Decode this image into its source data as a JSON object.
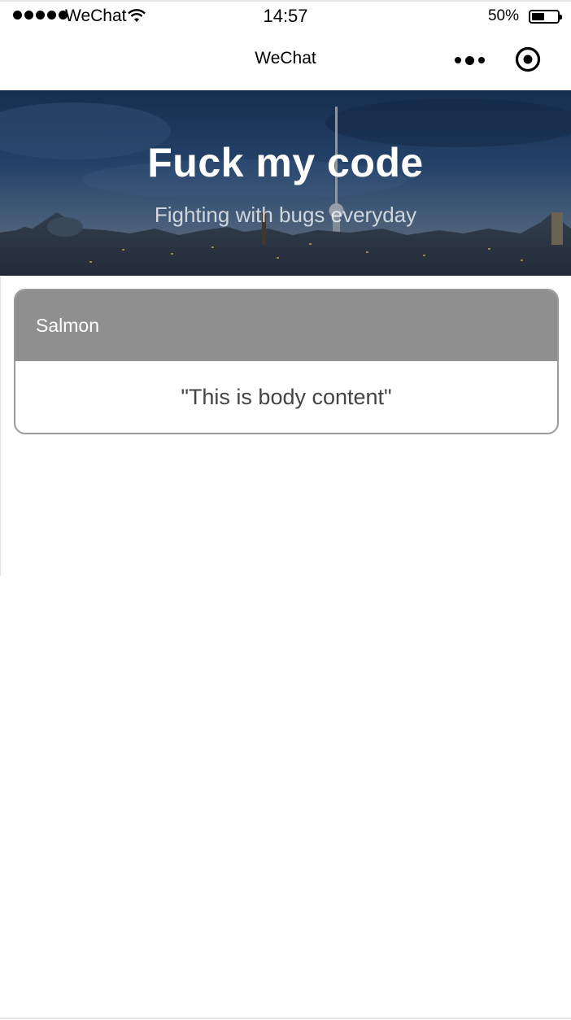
{
  "status_bar": {
    "carrier": "WeChat",
    "time": "14:57",
    "battery_percent": "50%",
    "battery_level": 0.5,
    "signal_icon": "signal-dots-icon",
    "wifi_icon": "wifi-icon",
    "battery_icon": "battery-icon"
  },
  "nav": {
    "title": "WeChat",
    "more_icon": "more-dots-icon",
    "record_icon": "record-circle-icon"
  },
  "banner": {
    "title": "Fuck my code",
    "subtitle": "Fighting with bugs everyday"
  },
  "card": {
    "header": "Salmon",
    "body": "\"This is body content\""
  },
  "colors": {
    "card_header_bg": "#8f8f8f",
    "card_border": "#9a9a9a",
    "body_text": "#444444"
  }
}
